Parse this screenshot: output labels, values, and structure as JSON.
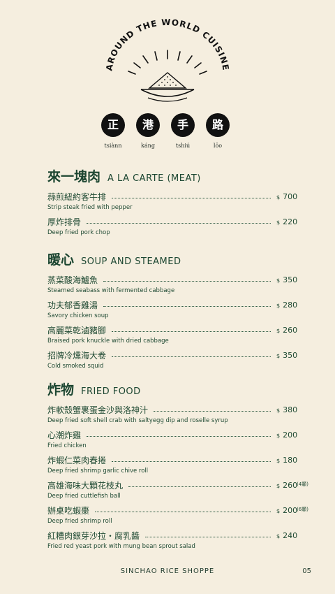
{
  "logo": {
    "arc_text": "AROUND THE WORLD CUISINE",
    "chars": [
      "正",
      "港",
      "手",
      "路"
    ],
    "romanization": [
      "tsiànn",
      "káng",
      "tshiú",
      "lōo"
    ]
  },
  "sections": [
    {
      "title_zh": "來一塊肉",
      "title_en": "A LA CARTE (MEAT)",
      "items": [
        {
          "zh": "蒜煎紐約客牛排",
          "en": "Strip steak fried with pepper",
          "currency": "$",
          "price": "700",
          "note": ""
        },
        {
          "zh": "厚炸排骨",
          "en": "Deep fried pork chop",
          "currency": "$",
          "price": "220",
          "note": ""
        }
      ]
    },
    {
      "title_zh": "暖心",
      "title_en": "SOUP AND STEAMED",
      "items": [
        {
          "zh": "蒸菜酸海鱸魚",
          "en": "Steamed seabass with fermented cabbage",
          "currency": "$",
          "price": "350",
          "note": ""
        },
        {
          "zh": "功夫郁香雞湯",
          "en": "Savory chicken soup",
          "currency": "$",
          "price": "280",
          "note": ""
        },
        {
          "zh": "高麗菜乾滷豬腳",
          "en": "Braised pork knuckle with dried cabbage",
          "currency": "$",
          "price": "260",
          "note": ""
        },
        {
          "zh": "招牌冷燻海大卷",
          "en": "Cold smoked squid",
          "currency": "$",
          "price": "350",
          "note": ""
        }
      ]
    },
    {
      "title_zh": "炸物",
      "title_en": "FRIED FOOD",
      "items": [
        {
          "zh": "炸軟殼蟹裹蛋金沙與洛神汁",
          "en": "Deep fried soft shell crab with saltyegg dip and roselle syrup",
          "currency": "$",
          "price": "380",
          "note": ""
        },
        {
          "zh": "心潮炸雞",
          "en": "Fried chicken",
          "currency": "$",
          "price": "200",
          "note": ""
        },
        {
          "zh": "炸蝦仁菜肉春捲",
          "en": "Deep fried shrimp garlic chive roll",
          "currency": "$",
          "price": "180",
          "note": ""
        },
        {
          "zh": "高雄海味大顆花枝丸",
          "en": "Deep fried cuttlefish ball",
          "currency": "$",
          "price": "260",
          "note": "(4顆)"
        },
        {
          "zh": "辦桌吃蝦棗",
          "en": "Deep fried shrimp roll",
          "currency": "$",
          "price": "200",
          "note": "(6顆)"
        },
        {
          "zh": "紅糟肉銀芽沙拉・腐乳醬",
          "en": "Fried red yeast pork with mung bean sprout salad",
          "currency": "$",
          "price": "240",
          "note": ""
        }
      ]
    }
  ],
  "footer": {
    "brand": "SINCHAO RICE SHOPPE",
    "page": "05"
  }
}
